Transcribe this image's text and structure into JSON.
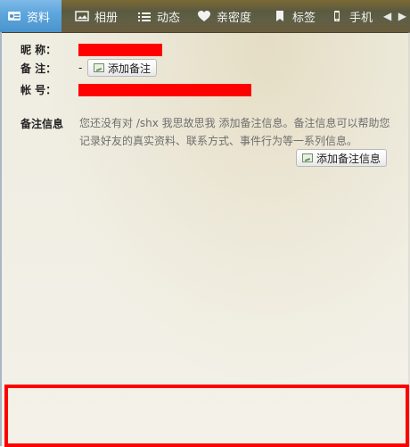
{
  "tabs": [
    {
      "label": "资料",
      "icon": "profile-card-icon",
      "active": true
    },
    {
      "label": "相册",
      "icon": "photo-album-icon",
      "active": false
    },
    {
      "label": "动态",
      "icon": "feed-list-icon",
      "active": false
    },
    {
      "label": "亲密度",
      "icon": "heart-icon",
      "active": false
    },
    {
      "label": "标签",
      "icon": "bookmark-icon",
      "active": false
    },
    {
      "label": "手机",
      "icon": "phone-icon",
      "active": false
    }
  ],
  "tab_nav": {
    "prev": "◀",
    "next": "▶"
  },
  "profile": {
    "nickname_label": "昵  称：",
    "remark_label": "备  注：",
    "remark_value": "-",
    "add_remark_button": "添加备注",
    "account_label": "帐  号：",
    "memo_label": "备注信息",
    "memo_text": "您还没有对 /shx 我思故思我 添加备注信息。备注信息可以帮助您记录好友的真实资料、联系方式、事件行为等一系列信息。",
    "add_memo_button": "添加备注信息"
  }
}
